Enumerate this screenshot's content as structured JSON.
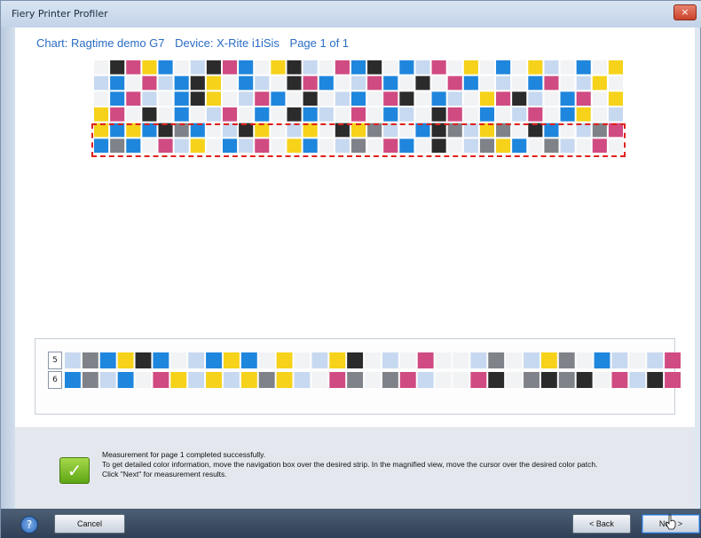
{
  "window": {
    "title": "Fiery Printer Profiler",
    "close_glyph": "×"
  },
  "chart_info": {
    "chart": "Chart: Ragtime demo G7",
    "device": "Device: X-Rite i1iSis",
    "page": "Page 1 of 1"
  },
  "colors": {
    "accent": "#2a6cc4",
    "nav_box": "#e0201b",
    "success": "#6fb41f"
  },
  "patch_grid": {
    "rows": [
      [
        "W",
        "K",
        "M",
        "Y",
        "C",
        "W",
        "L",
        "K",
        "M",
        "C",
        "W",
        "Y",
        "K",
        "L",
        "W",
        "M",
        "C",
        "K",
        "W",
        "C",
        "L",
        "M",
        "W",
        "Y",
        "W",
        "C",
        "W",
        "Y",
        "L",
        "W",
        "C",
        "W",
        "Y"
      ],
      [
        "L",
        "C",
        "W",
        "M",
        "L",
        "C",
        "K",
        "Y",
        "W",
        "C",
        "L",
        "W",
        "K",
        "M",
        "C",
        "W",
        "L",
        "M",
        "C",
        "W",
        "K",
        "W",
        "M",
        "C",
        "W",
        "L",
        "W",
        "C",
        "M",
        "W",
        "L",
        "Y",
        "W"
      ],
      [
        "W",
        "C",
        "M",
        "L",
        "W",
        "C",
        "K",
        "Y",
        "W",
        "L",
        "M",
        "C",
        "W",
        "K",
        "W",
        "L",
        "C",
        "W",
        "M",
        "K",
        "W",
        "C",
        "L",
        "W",
        "Y",
        "M",
        "K",
        "L",
        "W",
        "C",
        "M",
        "W",
        "Y"
      ],
      [
        "Y",
        "M",
        "W",
        "K",
        "W",
        "C",
        "W",
        "L",
        "M",
        "W",
        "C",
        "W",
        "K",
        "C",
        "L",
        "W",
        "M",
        "W",
        "C",
        "L",
        "W",
        "K",
        "M",
        "W",
        "C",
        "W",
        "L",
        "M",
        "W",
        "C",
        "Y",
        "W",
        "L"
      ],
      [
        "Y",
        "C",
        "Y",
        "C",
        "K",
        "D",
        "C",
        "W",
        "L",
        "K",
        "Y",
        "W",
        "L",
        "Y",
        "W",
        "K",
        "Y",
        "D",
        "L",
        "W",
        "C",
        "K",
        "D",
        "L",
        "Y",
        "D",
        "W",
        "K",
        "C",
        "W",
        "L",
        "D",
        "M"
      ],
      [
        "C",
        "D",
        "C",
        "W",
        "M",
        "L",
        "Y",
        "W",
        "C",
        "L",
        "M",
        "W",
        "Y",
        "C",
        "W",
        "L",
        "D",
        "W",
        "M",
        "C",
        "W",
        "K",
        "W",
        "L",
        "D",
        "Y",
        "C",
        "W",
        "D",
        "L",
        "W",
        "M",
        "W"
      ]
    ]
  },
  "magnified": {
    "strips": [
      {
        "label": "5",
        "patches": [
          "L",
          "D",
          "C",
          "Y",
          "K",
          "C",
          "W",
          "L",
          "C",
          "Y",
          "C",
          "W",
          "Y",
          "W",
          "L",
          "Y",
          "K",
          "W",
          "L",
          "W",
          "M",
          "W",
          "W",
          "L",
          "D",
          "W",
          "L",
          "Y",
          "D",
          "W",
          "C",
          "L",
          "W",
          "L",
          "M"
        ]
      },
      {
        "label": "6",
        "patches": [
          "C",
          "D",
          "L",
          "C",
          "W",
          "M",
          "Y",
          "L",
          "Y",
          "L",
          "Y",
          "D",
          "Y",
          "L",
          "W",
          "M",
          "D",
          "W",
          "D",
          "M",
          "L",
          "W",
          "W",
          "M",
          "K",
          "W",
          "D",
          "K",
          "D",
          "K",
          "W",
          "M",
          "L",
          "K",
          "M"
        ]
      }
    ]
  },
  "palette": {
    "W": "#f2f3f5",
    "L": "#c7d9f0",
    "C": "#1f86dd",
    "M": "#d04b82",
    "Y": "#f6d21a",
    "K": "#2b2b2b",
    "D": "#7f8389"
  },
  "message": {
    "line1": "Measurement for page 1 completed successfully.",
    "line2": "To get detailed color information, move the navigation box over the desired strip. In the magnified view, move the cursor over the desired color patch.",
    "line3": "Click \"Next\" for measurement results."
  },
  "buttons": {
    "cancel": "Cancel",
    "back": "< Back",
    "next": "Next >"
  },
  "icons": {
    "help": "?",
    "check": "✓"
  }
}
